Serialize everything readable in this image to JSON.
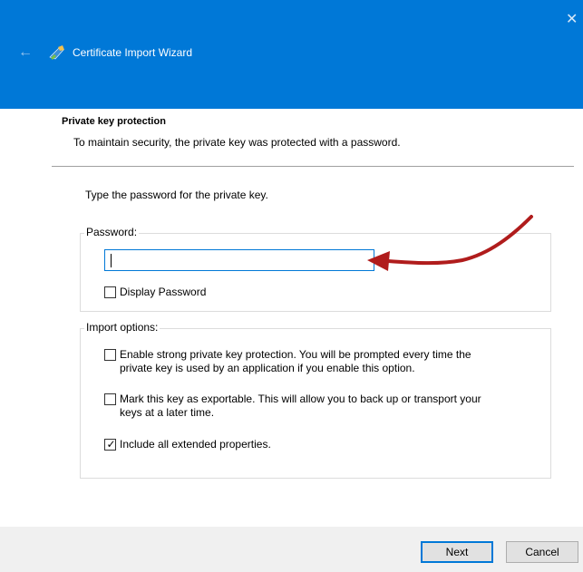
{
  "window": {
    "title": "Certificate Import Wizard",
    "accent_color": "#0078d7",
    "back_icon": "back-arrow-icon",
    "close_icon": "close-icon"
  },
  "page": {
    "heading": "Private key protection",
    "subheading": "To maintain security, the private key was protected with a password.",
    "instruction": "Type the password for the private key."
  },
  "password_group": {
    "legend": "Password:",
    "input_value": "",
    "display_password": {
      "label": "Display Password",
      "checked": false
    }
  },
  "import_options": {
    "legend": "Import options:",
    "options": [
      {
        "line1": "Enable strong private key protection. You will be prompted every time the",
        "line2": "private key is used by an application if you enable this option.",
        "checked": false
      },
      {
        "line1": "Mark this key as exportable. This will allow you to back up or transport your",
        "line2": "keys at a later time.",
        "checked": false
      },
      {
        "line1": "Include all extended properties.",
        "line2": "",
        "checked": true
      }
    ]
  },
  "footer": {
    "next_label": "Next",
    "cancel_label": "Cancel"
  },
  "annotation": {
    "type": "red-arrow-pointing-to-password-field",
    "color": "#b01c1c"
  }
}
